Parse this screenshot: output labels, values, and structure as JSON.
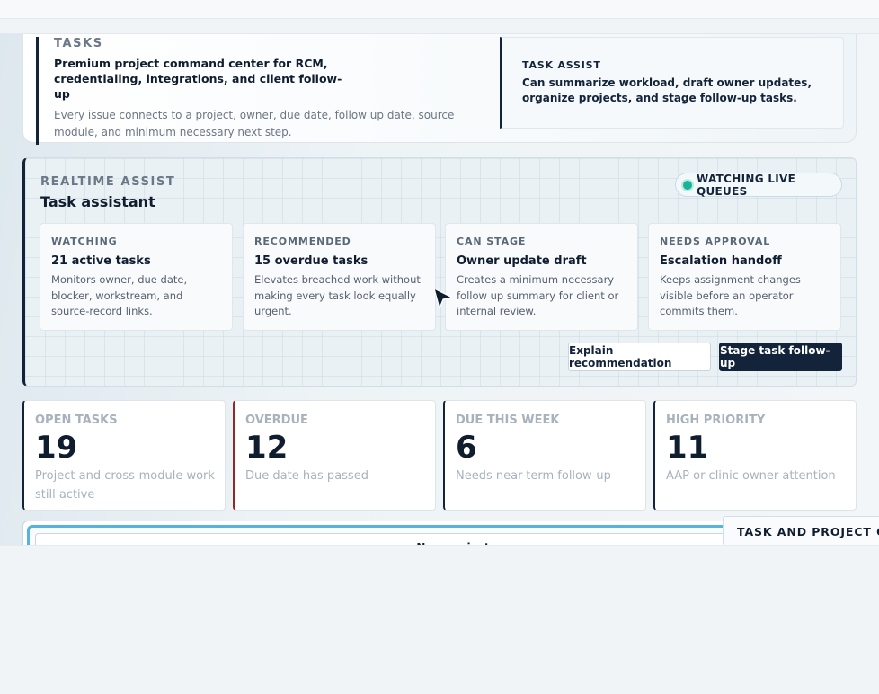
{
  "hero": {
    "eyebrow": "TASKS",
    "title": "Premium project command center for RCM, credentialing, integrations, and client follow-up",
    "description": "Every issue connects to a project, owner, due date, follow up date, source module, and minimum necessary next step.",
    "assist": {
      "label": "TASK ASSIST",
      "text": "Can summarize workload, draft owner updates, organize projects, and stage follow-up tasks."
    }
  },
  "realtime": {
    "eyebrow": "REALTIME ASSIST",
    "title": "Task assistant",
    "status_pill": "WATCHING LIVE QUEUES",
    "status_color": "#18b39a",
    "cards": [
      {
        "eyebrow": "WATCHING",
        "title": "21 active tasks",
        "description": "Monitors owner, due date, blocker, workstream, and source-record links."
      },
      {
        "eyebrow": "RECOMMENDED",
        "title": "15 overdue tasks",
        "description": "Elevates breached work without making every task look equally urgent."
      },
      {
        "eyebrow": "CAN STAGE",
        "title": "Owner update draft",
        "description": "Creates a minimum necessary follow up summary for client or internal review."
      },
      {
        "eyebrow": "NEEDS APPROVAL",
        "title": "Escalation handoff",
        "description": "Keeps assignment changes visible before an operator commits them."
      }
    ],
    "buttons": {
      "explain": "Explain recommendation",
      "stage": "Stage task follow-up"
    }
  },
  "stats": [
    {
      "label": "OPEN TASKS",
      "value": "19",
      "description": "Project and cross-module work still active"
    },
    {
      "label": "OVERDUE",
      "value": "12",
      "description": "Due date has passed"
    },
    {
      "label": "DUE THIS WEEK",
      "value": "6",
      "description": "Needs near-term follow-up"
    },
    {
      "label": "HIGH PRIORITY",
      "value": "11",
      "description": "AAP or clinic owner attention"
    }
  ],
  "new_project_label": "New project",
  "ops_tag": "TASK AND PROJECT OPS",
  "colors": {
    "navy": "#13243a",
    "overdue_accent": "#8a2a2a",
    "focus_ring": "#54b3df"
  }
}
